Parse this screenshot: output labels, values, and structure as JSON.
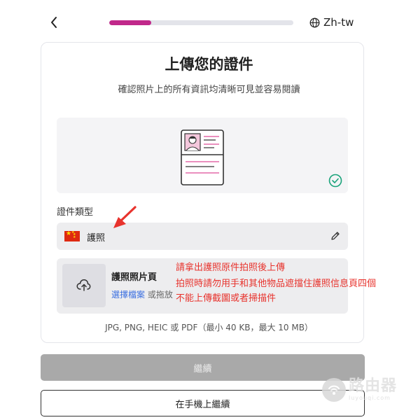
{
  "header": {
    "progress": 0.23,
    "language": "Zh-tw",
    "icons": {
      "back": "chevron-left-icon",
      "language": "globe-icon"
    }
  },
  "card": {
    "title": "上傳您的證件",
    "subtitle": "確認照片上的所有資訊均清晰可見並容易閱讀",
    "document_type": {
      "label": "證件類型",
      "value": "護照",
      "flag": "china-flag-icon"
    },
    "upload": {
      "title": "護照照片頁",
      "choose_file": "選擇檔案",
      "or_drag": "或拖放"
    },
    "formats": "JPG, PNG, HEIC 或 PDF（最小 40 KB，最大 10 MB）"
  },
  "buttons": {
    "continue": "繼續",
    "continue_on_phone": "在手機上繼續"
  },
  "annotations": [
    "請拿出護照原件拍照後上傳",
    "拍照時請勿用手和其他物品遮擋住護照信息頁四個",
    "不能上傳截圖或者掃描件"
  ],
  "watermark": {
    "main": "路由器",
    "sub": "luyouqi.com"
  },
  "colors": {
    "accent": "#c0288a",
    "annotation_red": "#e8332d",
    "link_blue": "#3b6fe0",
    "success_green": "#1aa37a"
  }
}
